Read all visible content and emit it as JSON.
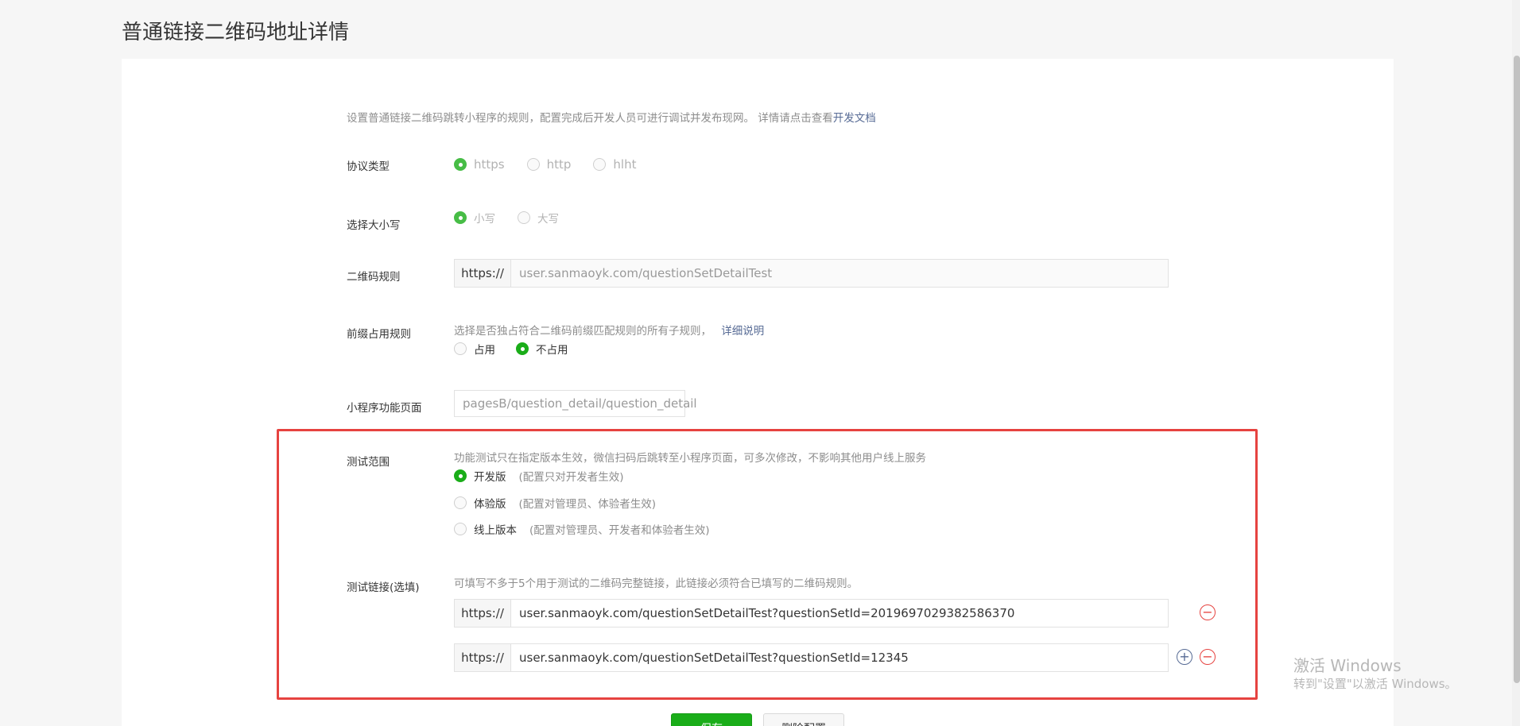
{
  "page": {
    "title": "普通链接二维码地址详情"
  },
  "intro": {
    "text": "设置普通链接二维码跳转小程序的规则，配置完成后开发人员可进行调试并发布现网。 详情请点击查看",
    "link": "开发文档"
  },
  "protocol": {
    "label": "协议类型",
    "options": [
      "https",
      "http",
      "hlht"
    ],
    "selected": "https"
  },
  "case": {
    "label": "选择大小写",
    "options": [
      "小写",
      "大写"
    ],
    "selected": "小写"
  },
  "qr_rule": {
    "label": "二维码规则",
    "prefix": "https://",
    "value": "user.sanmaoyk.com/questionSetDetailTest"
  },
  "prefix_rule": {
    "label": "前缀占用规则",
    "desc": "选择是否独占符合二维码前缀匹配规则的所有子规则，",
    "link": "详细说明",
    "options": [
      "占用",
      "不占用"
    ],
    "selected": "不占用"
  },
  "page_path": {
    "label": "小程序功能页面",
    "value": "pagesB/question_detail/question_detail"
  },
  "test_scope": {
    "label": "测试范围",
    "desc": "功能测试只在指定版本生效，微信扫码后跳转至小程序页面，可多次修改，不影响其他用户线上服务",
    "options": [
      {
        "name": "开发版",
        "note": "(配置只对开发者生效)"
      },
      {
        "name": "体验版",
        "note": "(配置对管理员、体验者生效)"
      },
      {
        "name": "线上版本",
        "note": "(配置对管理员、开发者和体验者生效)"
      }
    ],
    "selected": "开发版"
  },
  "test_links": {
    "label": "测试链接(选填)",
    "desc": "可填写不多于5个用于测试的二维码完整链接，此链接必须符合已填写的二维码规则。",
    "prefix": "https://",
    "links": [
      "user.sanmaoyk.com/questionSetDetailTest?questionSetId=2019697029382586370",
      "user.sanmaoyk.com/questionSetDetailTest?questionSetId=12345"
    ],
    "add_icon": "+",
    "remove_icon": "−"
  },
  "buttons": {
    "save": "保存",
    "delete": "删除配置"
  },
  "watermark": {
    "line1": "激活 Windows",
    "line2": "转到\"设置\"以激活 Windows。"
  },
  "colors": {
    "accent": "#1aad19",
    "link": "#576b95",
    "highlight": "#e64340"
  }
}
